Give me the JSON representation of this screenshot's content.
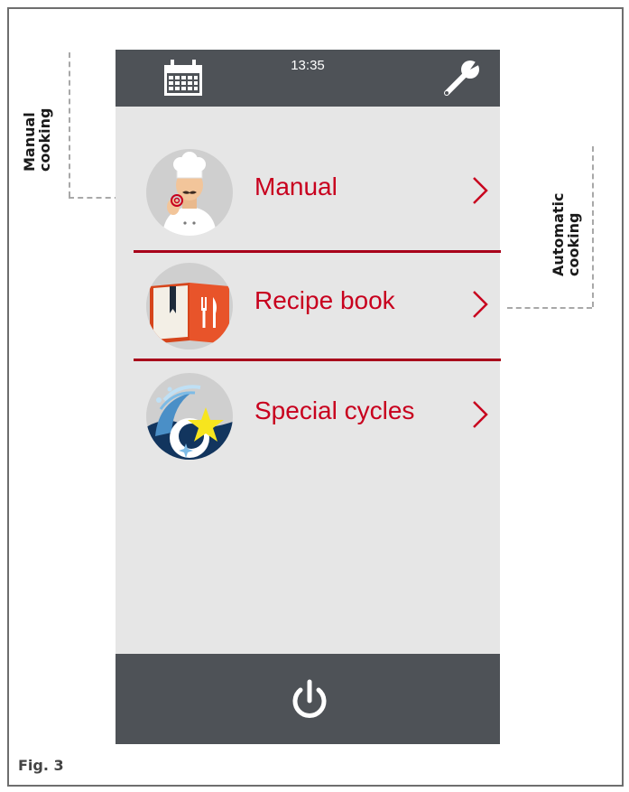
{
  "status_bar": {
    "time": "13:35",
    "left_icon": "calendar-icon",
    "right_icon": "wrench-icon"
  },
  "menu": {
    "items": [
      {
        "label": "Manual",
        "icon": "chef-icon"
      },
      {
        "label": "Recipe book",
        "icon": "recipe-book-icon"
      },
      {
        "label": "Special cycles",
        "icon": "special-cycles-icon"
      }
    ]
  },
  "bottom_bar": {
    "icon": "power-icon"
  },
  "annotations": {
    "left_line1": "Manual",
    "left_line2": "cooking",
    "right_line1": "Automatic",
    "right_line2": "cooking"
  },
  "caption": "Fig. 3",
  "colors": {
    "bar": "#4e5257",
    "screen": "#e6e6e6",
    "accent": "#c8001e",
    "divider": "#a8001a"
  }
}
